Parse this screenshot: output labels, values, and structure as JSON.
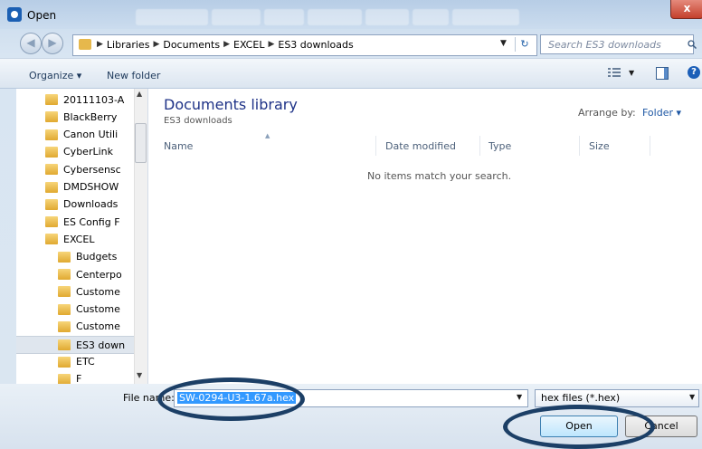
{
  "window": {
    "title": "Open",
    "close_label": "x"
  },
  "address": {
    "crumbs": [
      "Libraries",
      "Documents",
      "EXCEL",
      "ES3 downloads"
    ],
    "search_placeholder": "Search ES3 downloads"
  },
  "toolbar": {
    "organize_label": "Organize ▾",
    "new_folder_label": "New folder"
  },
  "nav": {
    "items": [
      {
        "label": "20111103-A",
        "indent": 0
      },
      {
        "label": "BlackBerry",
        "indent": 0
      },
      {
        "label": "Canon Utili",
        "indent": 0
      },
      {
        "label": "CyberLink",
        "indent": 0
      },
      {
        "label": "Cybersensc",
        "indent": 0
      },
      {
        "label": "DMDSHOW",
        "indent": 0
      },
      {
        "label": "Downloads",
        "indent": 0
      },
      {
        "label": "ES Config F",
        "indent": 0
      },
      {
        "label": "EXCEL",
        "indent": 0
      },
      {
        "label": "Budgets",
        "indent": 1
      },
      {
        "label": "Centerpo",
        "indent": 1
      },
      {
        "label": "Custome",
        "indent": 1
      },
      {
        "label": "Custome",
        "indent": 1
      },
      {
        "label": "Custome",
        "indent": 1
      },
      {
        "label": "ES3 down",
        "indent": 1,
        "selected": true
      },
      {
        "label": "ETC",
        "indent": 1
      },
      {
        "label": "F",
        "indent": 1
      }
    ]
  },
  "main": {
    "library_title": "Documents library",
    "library_subtitle": "ES3 downloads",
    "arrange_label": "Arrange by:",
    "arrange_value": "Folder ▾",
    "columns": [
      "Name",
      "Date modified",
      "Type",
      "Size"
    ],
    "empty_message": "No items match your search."
  },
  "bottom": {
    "file_name_label": "File name:",
    "file_name_value": "SW-0294-U3-1.67a.hex",
    "file_type_value": "hex files (*.hex)",
    "open_label": "Open",
    "cancel_label": "Cancel"
  },
  "colors": {
    "annotation": "#1c3f66",
    "accent": "#1e3287"
  }
}
